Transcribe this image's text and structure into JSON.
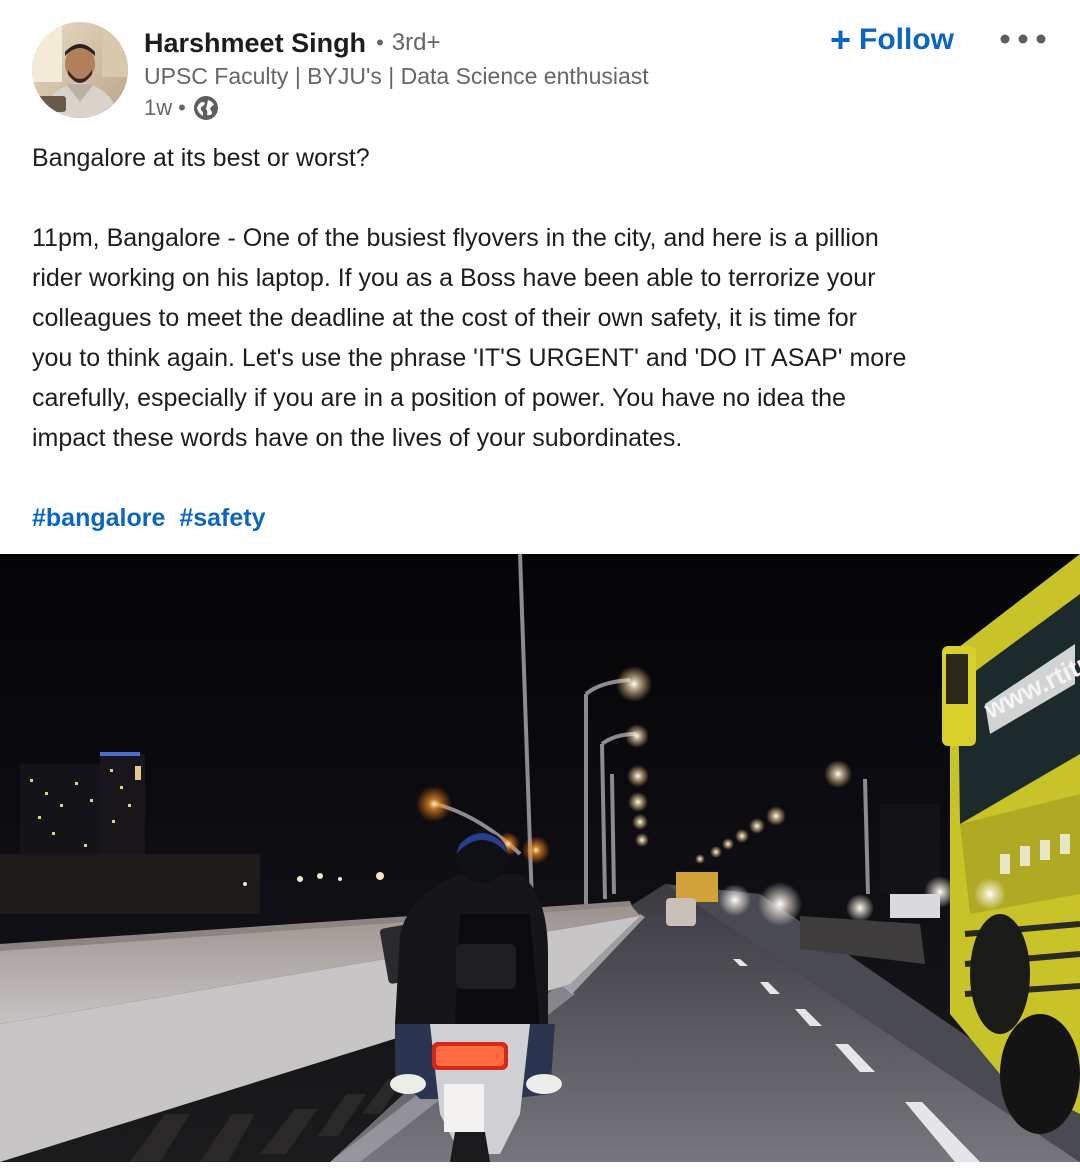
{
  "post": {
    "author": {
      "name": "Harshmeet Singh",
      "separator": "•",
      "degree": "3rd+",
      "headline": "UPSC Faculty | BYJU's | Data Science enthusiast",
      "time": "1w",
      "visibility_icon": "globe-icon"
    },
    "actions": {
      "follow_plus": "+",
      "follow_label": "Follow",
      "more_icon": "ellipsis-icon"
    },
    "text": {
      "line1": "Bangalore at its best or worst?",
      "paragraph": [
        "11pm, Bangalore - One of the busiest flyovers in the city, and here is a pillion",
        "rider working on his laptop. If you as a Boss have been able to terrorize your",
        "colleagues to meet the deadline at the cost of their own safety, it is time for",
        "you to think again. Let's use the phrase 'IT'S URGENT' and 'DO IT ASAP' more",
        "carefully, especially if you are in a position of power. You have no idea the",
        "impact these words have on the lives of your subordinates."
      ],
      "hashtags": [
        "#bangalore",
        "#safety"
      ]
    },
    "image": {
      "bus_text": "www.rtitr"
    },
    "colors": {
      "accent": "#0a66c2",
      "text": "#1d1d1d",
      "muted": "#666666"
    }
  }
}
